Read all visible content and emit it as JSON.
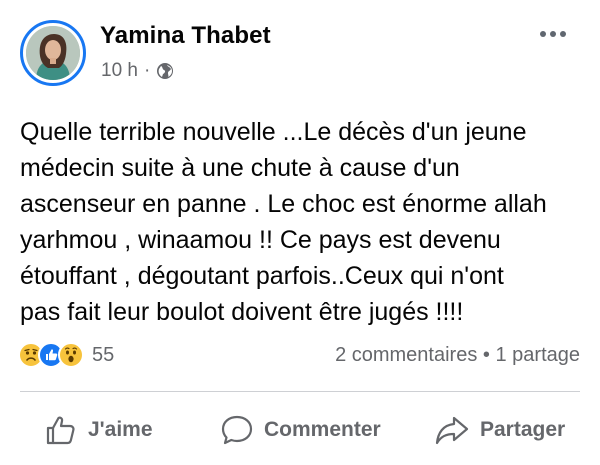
{
  "post": {
    "author": "Yamina Thabet",
    "time": "10 h",
    "separator": "·",
    "text_lines": [
      "Quelle terrible nouvelle ...Le décès d'un jeune",
      "médecin suite à une chute à cause d'un",
      "ascenseur en panne . Le choc est énorme allah",
      "yarhmou , winaamou !! Ce pays est devenu",
      "étouffant , dégoutant parfois..Ceux qui n'ont",
      "pas fait leur boulot doivent être jugés !!!!"
    ]
  },
  "stats": {
    "reactions": [
      "sad-reaction-icon",
      "like-reaction-icon",
      "wow-reaction-icon"
    ],
    "reaction_count": "55",
    "comments": "2 commentaires",
    "dot": "•",
    "shares": "1 partage"
  },
  "actions": {
    "like": "J'aime",
    "comment": "Commenter",
    "share": "Partager"
  },
  "colors": {
    "accent": "#1877f2",
    "secondary_text": "#65676b",
    "reaction_yellow": "#f7c33c"
  }
}
